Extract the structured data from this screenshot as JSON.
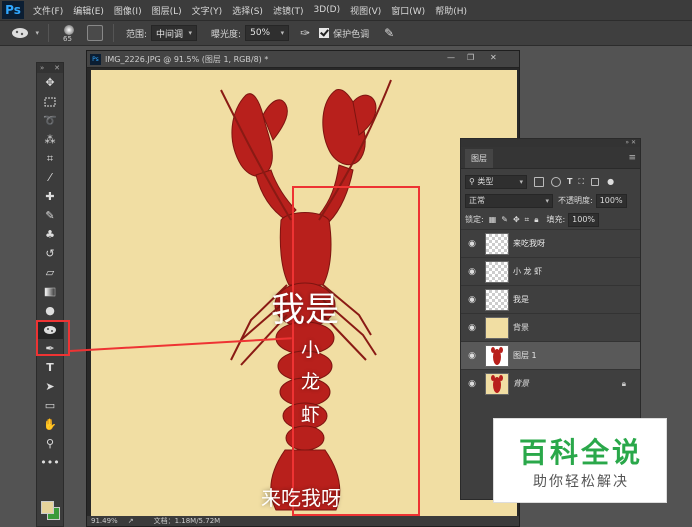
{
  "app": {
    "logo": "Ps"
  },
  "menu": [
    "文件(F)",
    "编辑(E)",
    "图像(I)",
    "图层(L)",
    "文字(Y)",
    "选择(S)",
    "滤镜(T)",
    "3D(D)",
    "视图(V)",
    "窗口(W)",
    "帮助(H)"
  ],
  "options": {
    "brush_size": "65",
    "range_label": "范围:",
    "range_value": "中间调",
    "exposure_label": "曝光度:",
    "exposure_value": "50%",
    "protect_label": "保护色调",
    "protect_checked": true
  },
  "document": {
    "tab_title": "IMG_2226.JPG @ 91.5% (图层 1, RGB/8) *",
    "status_zoom": "91.49%",
    "status_doc": "文档：1.18M/5.72M",
    "canvas_bg": "#f1dea3",
    "overlay": {
      "line1": "我是",
      "chars": [
        "小",
        "龙",
        "虾"
      ],
      "bottom": "来吃我呀"
    }
  },
  "layers_panel": {
    "tab": "图层",
    "kind_label": "类型",
    "blend_mode": "正常",
    "opacity_label": "不透明度:",
    "opacity_value": "100%",
    "lock_label": "锁定:",
    "fill_label": "填充:",
    "fill_value": "100%",
    "layers": [
      {
        "name": "来吃我呀",
        "thumb": "checker",
        "selected": false,
        "italic": false
      },
      {
        "name": "小 龙 虾",
        "thumb": "checker",
        "selected": false,
        "italic": false
      },
      {
        "name": "我是",
        "thumb": "checker",
        "selected": false,
        "italic": false
      },
      {
        "name": "背景",
        "thumb": "fill",
        "selected": false,
        "italic": false
      },
      {
        "name": "图层 1",
        "thumb": "crayfish",
        "selected": true,
        "italic": false
      },
      {
        "name": "背景",
        "thumb": "crayfish",
        "selected": false,
        "italic": true,
        "locked": true
      }
    ]
  },
  "watermark": {
    "big": "百科全说",
    "small": "助你轻松解决"
  },
  "colors": {
    "accent_red": "#e33333",
    "watermark_green": "#2aa84a"
  }
}
